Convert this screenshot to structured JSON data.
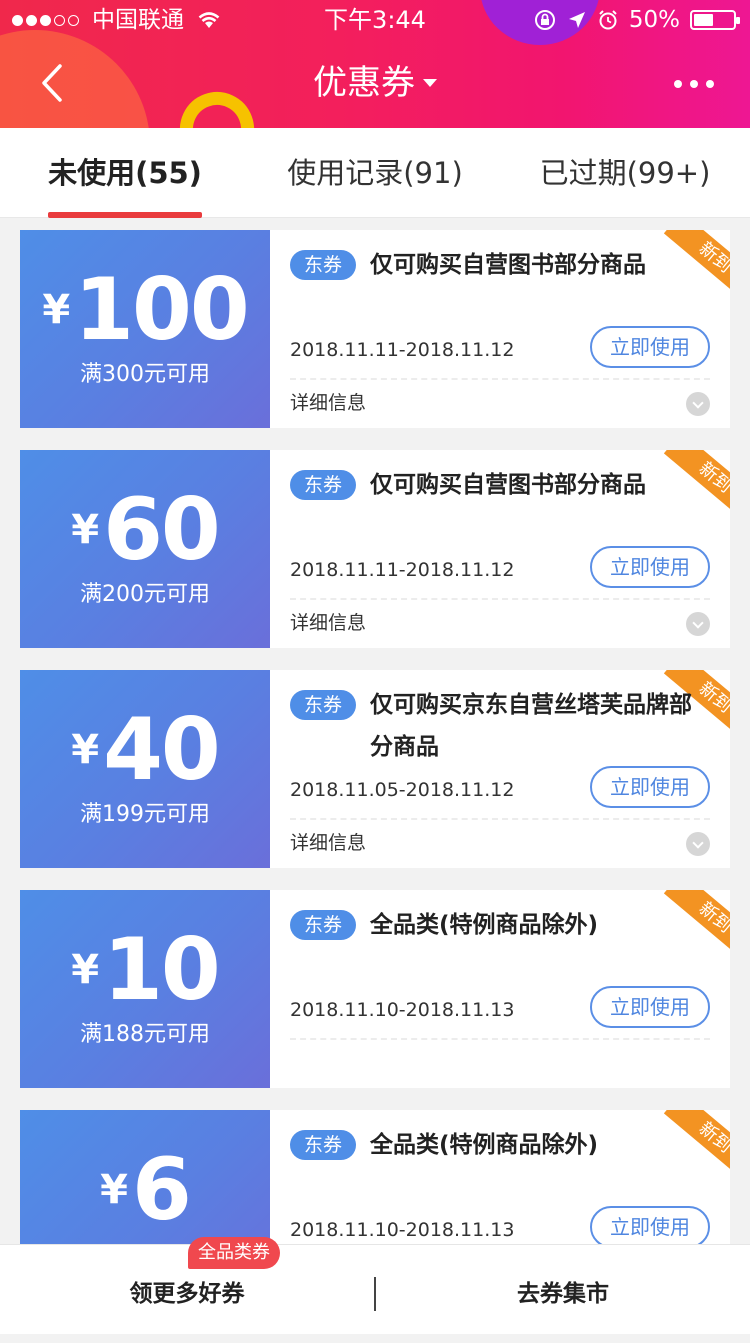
{
  "status_bar": {
    "carrier": "中国联通",
    "time": "下午3:44",
    "battery": "50%",
    "battery_level": 0.5
  },
  "header": {
    "title": "优惠券"
  },
  "tabs": [
    {
      "label": "未使用(55)",
      "active": true
    },
    {
      "label": "使用记录(91)",
      "active": false
    },
    {
      "label": "已过期(99+)",
      "active": false
    }
  ],
  "coupons": [
    {
      "currency": "¥",
      "amount": "100",
      "condition": "满300元可用",
      "tag": "东券",
      "title": "仅可购买自营图书部分商品",
      "date": "2018.11.11-2018.11.12",
      "button": "立即使用",
      "detail": "详细信息",
      "ribbon": "新到"
    },
    {
      "currency": "¥",
      "amount": "60",
      "condition": "满200元可用",
      "tag": "东券",
      "title": "仅可购买自营图书部分商品",
      "date": "2018.11.11-2018.11.12",
      "button": "立即使用",
      "detail": "详细信息",
      "ribbon": "新到"
    },
    {
      "currency": "¥",
      "amount": "40",
      "condition": "满199元可用",
      "tag": "东券",
      "title": "仅可购买京东自营丝塔芙品牌部分商品",
      "date": "2018.11.05-2018.11.12",
      "button": "立即使用",
      "detail": "详细信息",
      "ribbon": "新到"
    },
    {
      "currency": "¥",
      "amount": "10",
      "condition": "满188元可用",
      "tag": "东券",
      "title": "全品类(特例商品除外)",
      "date": "2018.11.10-2018.11.13",
      "button": "立即使用",
      "detail": "",
      "ribbon": "新到"
    },
    {
      "currency": "¥",
      "amount": "6",
      "condition": "",
      "tag": "东券",
      "title": "全品类(特例商品除外)",
      "date": "2018.11.10-2018.11.13",
      "button": "立即使用",
      "detail": "",
      "ribbon": "新到"
    }
  ],
  "bottom_bar": {
    "left_label": "领更多好券",
    "left_badge": "全品类券",
    "right_label": "去券集市"
  },
  "colors": {
    "header_red": "#f0284b",
    "header_pink": "#ee1793",
    "coupon_blue": "#4f8ee7",
    "ribbon_orange": "#f39322",
    "tab_underline": "#e93b3d"
  }
}
